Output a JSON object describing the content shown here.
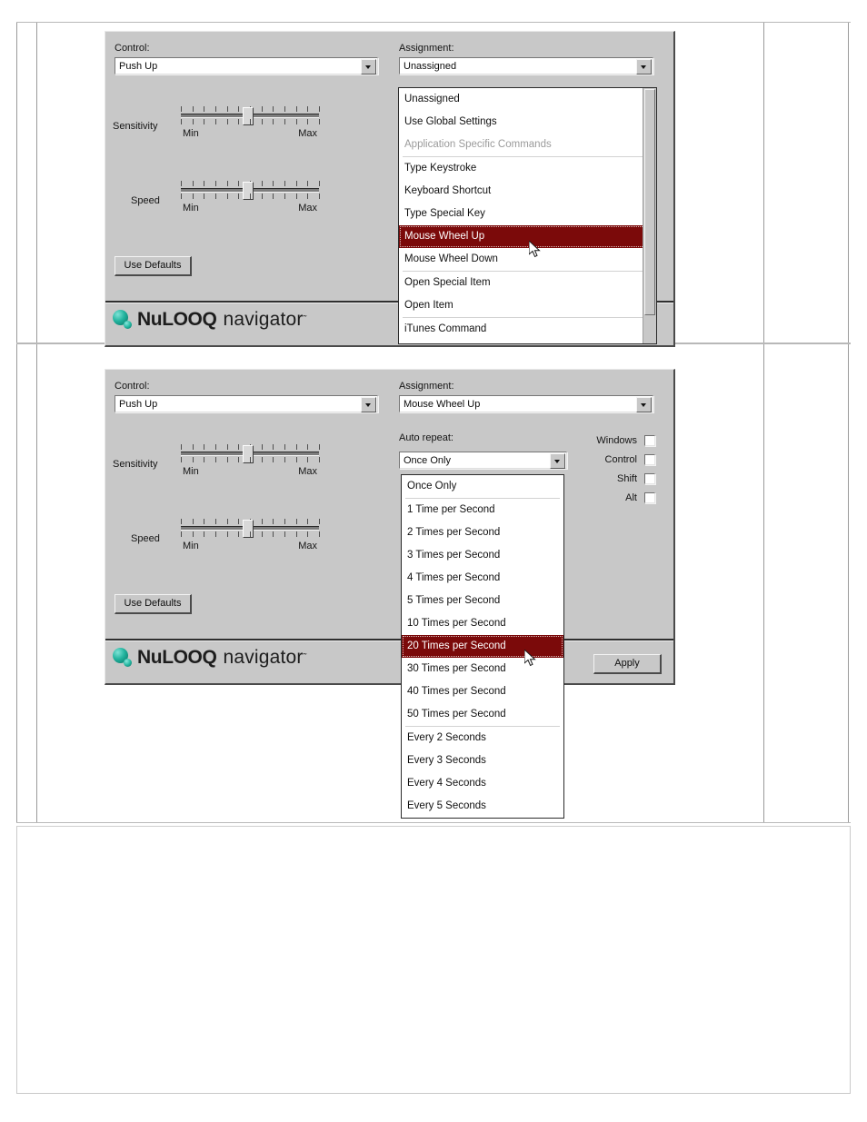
{
  "app": {
    "brand_name": "NuLOOQ",
    "brand_product": "navigator",
    "brand_tm": "˜",
    "orb_color": "#22b39e",
    "highlight_color": "#7b0a0a",
    "dialog_face": "#c8c8c8"
  },
  "panel1": {
    "control_label": "Control:",
    "control_value": "Push Up",
    "assignment_label": "Assignment:",
    "assignment_value": "Unassigned",
    "sensitivity_label": "Sensitivity",
    "speed_label": "Speed",
    "min_label": "Min",
    "max_label": "Max",
    "use_defaults_label": "Use Defaults",
    "assignment_options": [
      {
        "label": "Unassigned",
        "state": "normal"
      },
      {
        "label": "Use Global Settings",
        "state": "normal"
      },
      {
        "label": "Application Specific Commands",
        "state": "disabled"
      },
      {
        "label": "Type Keystroke",
        "state": "normal"
      },
      {
        "label": "Keyboard Shortcut",
        "state": "normal"
      },
      {
        "label": "Type Special Key",
        "state": "normal"
      },
      {
        "label": "Mouse Wheel Up",
        "state": "selected"
      },
      {
        "label": "Mouse Wheel Down",
        "state": "normal"
      },
      {
        "label": "Open Special Item",
        "state": "normal"
      },
      {
        "label": "Open Item",
        "state": "normal"
      },
      {
        "label": "iTunes Command",
        "state": "normal"
      }
    ],
    "separator_after": [
      2,
      7,
      9
    ]
  },
  "panel2": {
    "control_label": "Control:",
    "control_value": "Push Up",
    "assignment_label": "Assignment:",
    "assignment_value": "Mouse Wheel Up",
    "autorepeat_label": "Auto repeat:",
    "autorepeat_value": "Once Only",
    "sensitivity_label": "Sensitivity",
    "speed_label": "Speed",
    "min_label": "Min",
    "max_label": "Max",
    "use_defaults_label": "Use Defaults",
    "apply_label": "Apply",
    "modifiers": [
      {
        "label": "Windows",
        "checked": false
      },
      {
        "label": "Control",
        "checked": false
      },
      {
        "label": "Shift",
        "checked": false
      },
      {
        "label": "Alt",
        "checked": false
      }
    ],
    "autorepeat_options": [
      {
        "label": "Once Only",
        "state": "normal"
      },
      {
        "label": "1 Time per Second",
        "state": "normal"
      },
      {
        "label": "2 Times per Second",
        "state": "normal"
      },
      {
        "label": "3 Times per Second",
        "state": "normal"
      },
      {
        "label": "4 Times per Second",
        "state": "normal"
      },
      {
        "label": "5 Times per Second",
        "state": "normal"
      },
      {
        "label": "10 Times per Second",
        "state": "normal"
      },
      {
        "label": "20 Times per Second",
        "state": "selected"
      },
      {
        "label": "30 Times per Second",
        "state": "normal"
      },
      {
        "label": "40 Times per Second",
        "state": "normal"
      },
      {
        "label": "50 Times per Second",
        "state": "normal"
      },
      {
        "label": "Every 2 Seconds",
        "state": "normal"
      },
      {
        "label": "Every 3 Seconds",
        "state": "normal"
      },
      {
        "label": "Every 4 Seconds",
        "state": "normal"
      },
      {
        "label": "Every 5 Seconds",
        "state": "normal"
      }
    ],
    "separator_after": [
      0,
      10
    ]
  }
}
